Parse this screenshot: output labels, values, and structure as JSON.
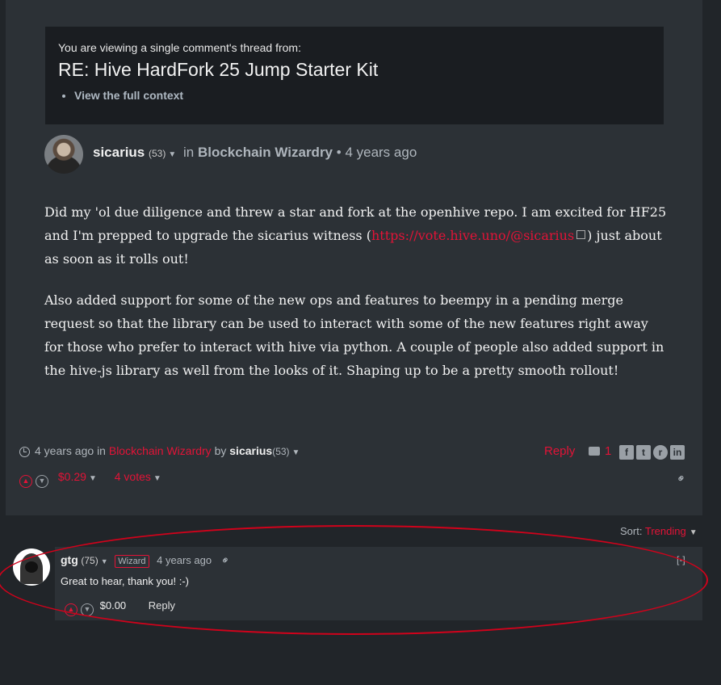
{
  "context": {
    "intro": "You are viewing a single comment's thread from:",
    "title": "RE: Hive HardFork 25 Jump Starter Kit",
    "full_context_link": "View the full context"
  },
  "post": {
    "author": "sicarius",
    "reputation": "(53)",
    "in_label": "in",
    "community": "Blockchain Wizardry",
    "separator": "•",
    "time": "4 years ago",
    "paragraph1_before": "Did my 'ol due diligence and threw a star and fork at the openhive repo. I am excited for HF25 and I'm prepped to upgrade the sicarius witness (",
    "paragraph1_link": "https://vote.hive.uno/@sicarius",
    "paragraph1_after": ") just about as soon as it rolls out!",
    "paragraph2": "Also added support for some of the new ops and features to beempy in a pending merge request so that the library can be used to interact with some of the new features right away for those who prefer to interact with hive via python. A couple of people also added support in the hive-js library as well from the looks of it. Shaping up to be a pretty smooth rollout!"
  },
  "footer": {
    "time": "4 years ago",
    "in_label": "in",
    "community": "Blockchain Wizardry",
    "by_label": "by",
    "author": "sicarius",
    "reputation": "(53)",
    "reply_label": "Reply",
    "comment_count": "1",
    "payout": "$0.29",
    "votes": "4 votes"
  },
  "sort": {
    "label": "Sort:",
    "value": "Trending"
  },
  "reply": {
    "author": "gtg",
    "reputation": "(75)",
    "badge": "Wizard",
    "time": "4 years ago",
    "collapse": "[-]",
    "body": "Great to hear, thank you! :-)",
    "payout": "$0.00",
    "reply_label": "Reply"
  },
  "share_icons": [
    "facebook-icon",
    "twitter-icon",
    "reddit-icon",
    "linkedin-icon"
  ],
  "colors": {
    "accent": "#e31337",
    "background": "#212529",
    "card": "#2c3136",
    "annotation": "#d0021b"
  }
}
